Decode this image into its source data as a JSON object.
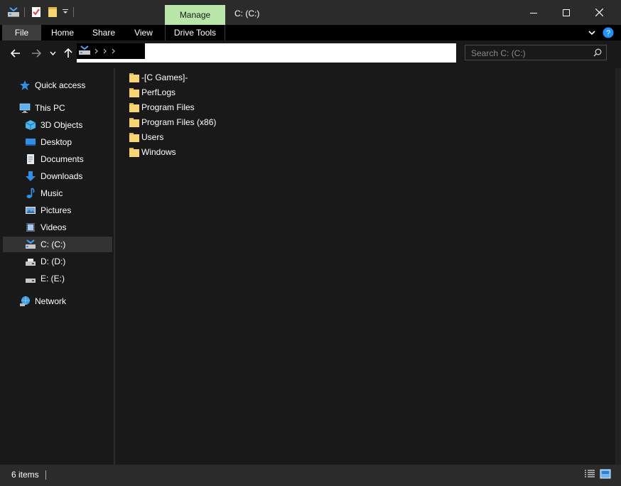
{
  "window": {
    "title": "C: (C:)",
    "context_tab": "Manage"
  },
  "ribbon": {
    "tabs": [
      "File",
      "Home",
      "Share",
      "View",
      "Drive Tools"
    ]
  },
  "search": {
    "placeholder": "Search C: (C:)"
  },
  "navpane": {
    "quick_access": "Quick access",
    "this_pc": "This PC",
    "items": [
      "3D Objects",
      "Desktop",
      "Documents",
      "Downloads",
      "Music",
      "Pictures",
      "Videos",
      "C: (C:)",
      "D: (D:)",
      "E: (E:)"
    ],
    "network": "Network",
    "selected": "C: (C:)"
  },
  "content": {
    "folders": [
      "-[C Games]-",
      "PerfLogs",
      "Program Files",
      "Program Files (x86)",
      "Users",
      "Windows"
    ]
  },
  "status": {
    "count": "6 items"
  },
  "colors": {
    "manage_tab": "#b8e6a8",
    "folder": "#f6d572",
    "selection": "#333333",
    "help_icon": "#1e90ff"
  }
}
